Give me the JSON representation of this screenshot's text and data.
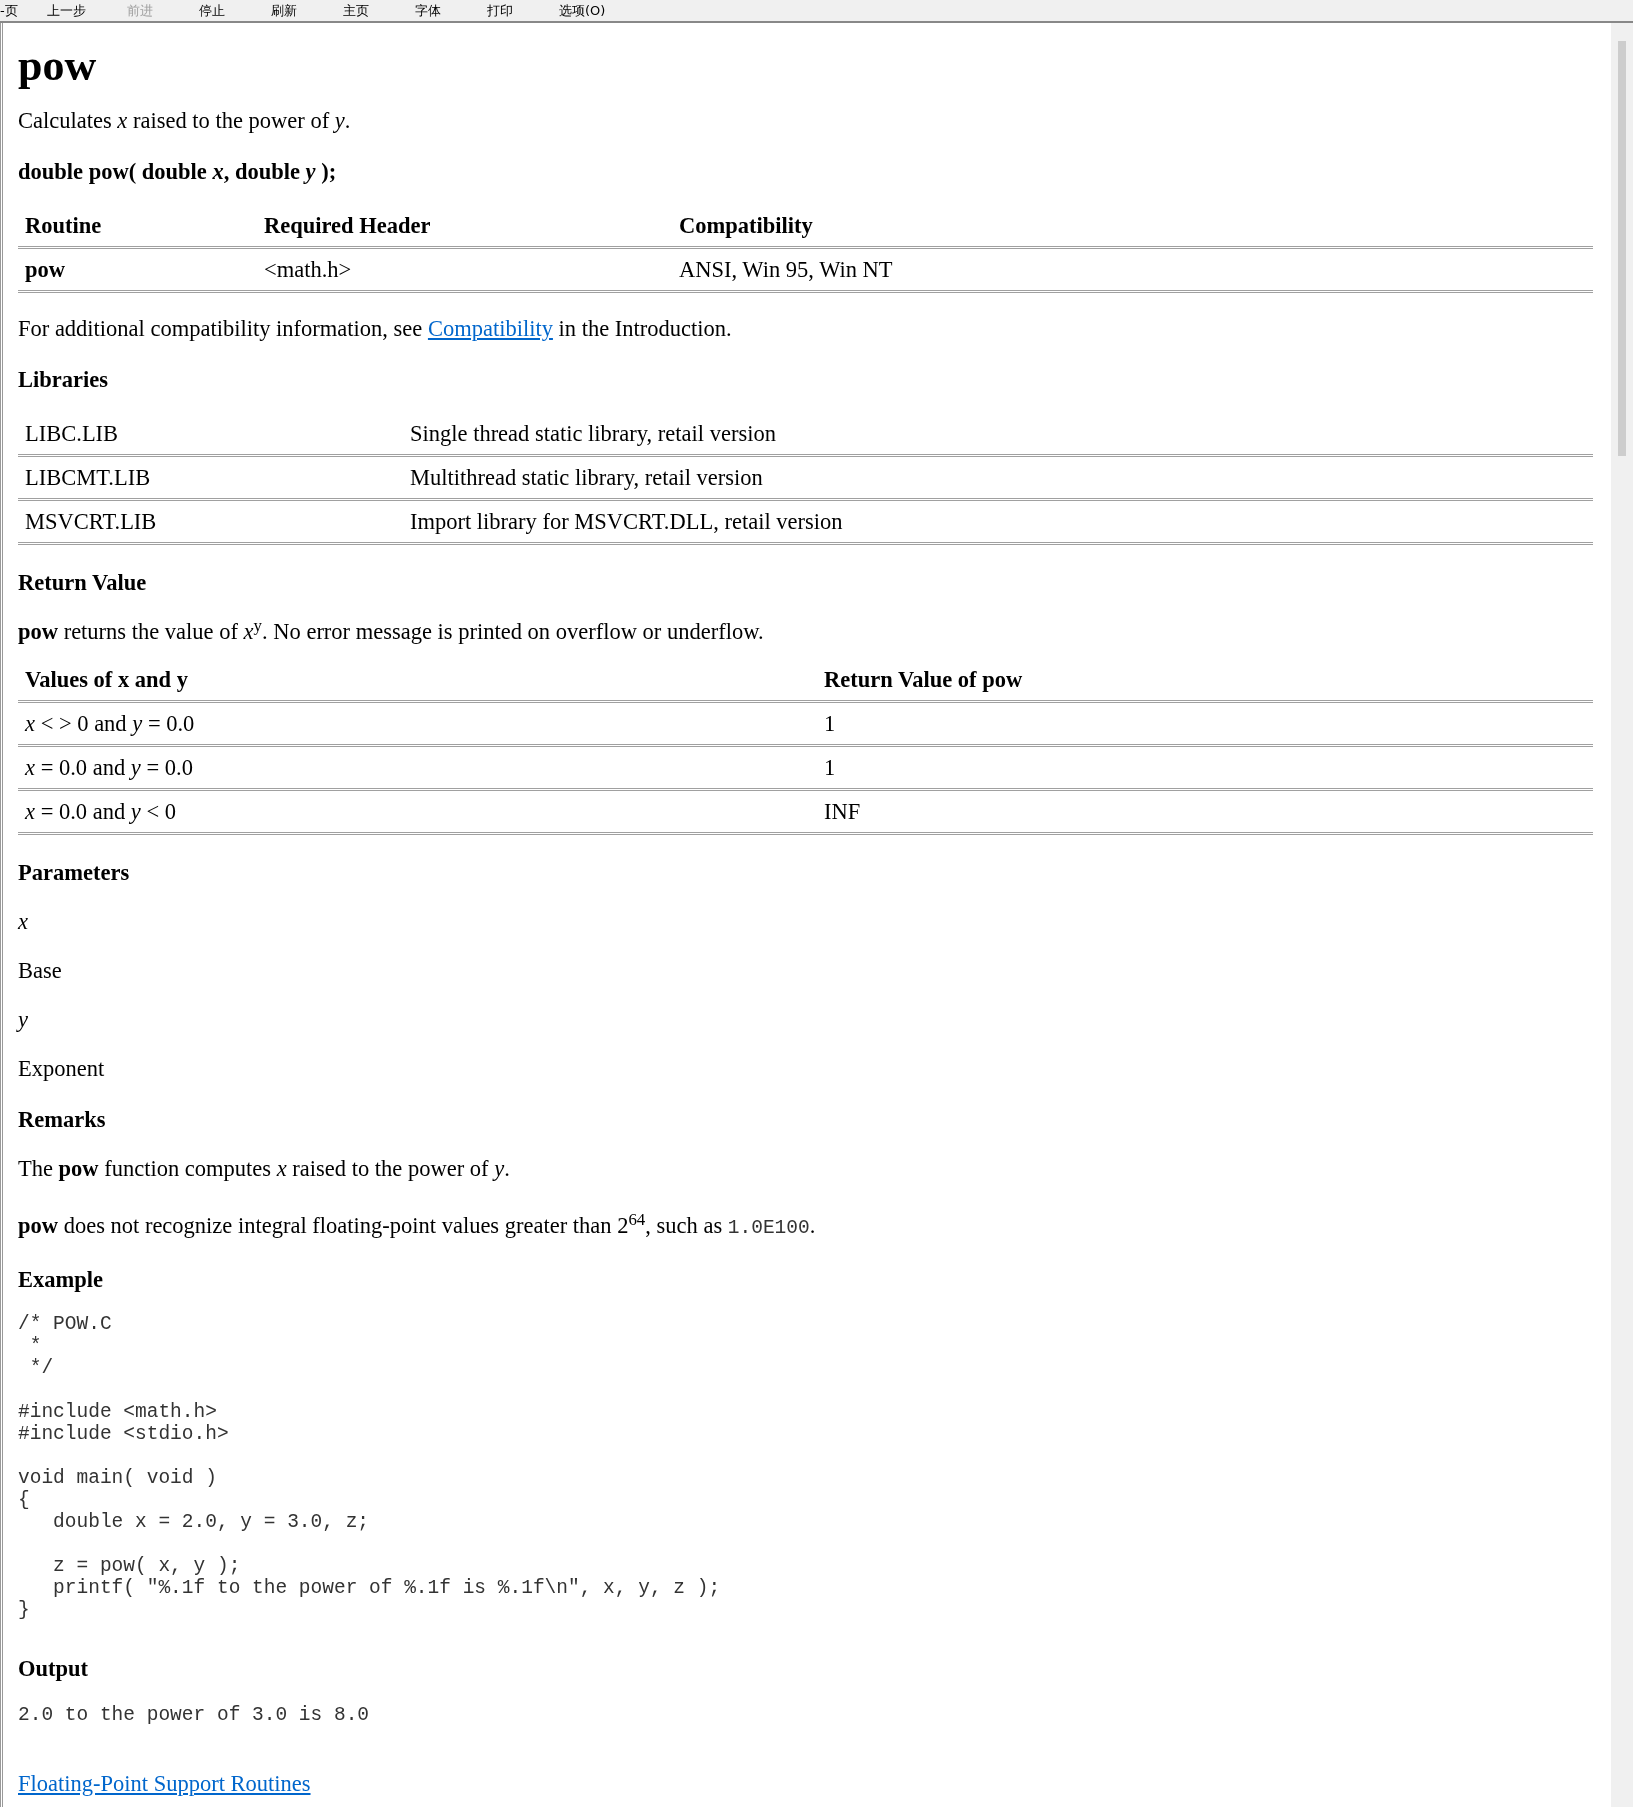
{
  "toolbar": [
    {
      "label": "-页",
      "disabled": false
    },
    {
      "label": "上一步",
      "disabled": false
    },
    {
      "label": "前进",
      "disabled": true
    },
    {
      "label": "停止",
      "disabled": false
    },
    {
      "label": "刷新",
      "disabled": false
    },
    {
      "label": "主页",
      "disabled": false
    },
    {
      "label": "字体",
      "disabled": false
    },
    {
      "label": "打印",
      "disabled": false
    },
    {
      "label": "选项(O)",
      "disabled": false
    }
  ],
  "title": "pow",
  "summary": "Calculates *x* raised to the power of *y*.",
  "syntax": "double pow( double *x*, double *y* );",
  "requirements_table": {
    "columns": [
      "Routine",
      "Required Header",
      "Compatibility"
    ],
    "rows": [
      [
        "pow",
        "<math.h>",
        "ANSI, Win 95, Win NT"
      ]
    ]
  },
  "compat_note": [
    {
      "kind": "text",
      "text": "For additional compatibility information, see "
    },
    {
      "kind": "link",
      "text": "Compatibility"
    },
    {
      "kind": "text",
      "text": " in the Introduction."
    }
  ],
  "libraries_heading": "Libraries",
  "libraries": [
    [
      "LIBC.LIB",
      "Single thread static library, retail version"
    ],
    [
      "LIBCMT.LIB",
      "Multithread static library, retail version"
    ],
    [
      "MSVCRT.LIB",
      "Import library for MSVCRT.DLL, retail version"
    ]
  ],
  "return_heading": "Return Value",
  "return_text": "**pow** returns the value of *x*$^{y}$. No error message is printed on overflow or underflow.",
  "values_table": {
    "columns": [
      "Values of x and y",
      "Return Value of pow"
    ],
    "rows": [
      [
        "*x* < > 0 and *y* = 0.0",
        "1"
      ],
      [
        "*x* = 0.0 and *y* = 0.0",
        "1"
      ],
      [
        "*x* = 0.0 and *y* < 0",
        "INF"
      ]
    ]
  },
  "parameters_heading": "Parameters",
  "parameters": [
    {
      "name": "x",
      "description": "Base"
    },
    {
      "name": "y",
      "description": "Exponent"
    }
  ],
  "remarks_heading": "Remarks",
  "remarks": [
    [
      {
        "kind": "text",
        "text": "The **pow** function computes *x* raised to the power of *y*."
      }
    ],
    [
      {
        "kind": "text",
        "text": "**pow** does not recognize integral floating-point values greater than 2$^{64}$, such as "
      },
      {
        "kind": "code",
        "text": "1.0E100"
      },
      {
        "kind": "text",
        "text": "."
      }
    ]
  ],
  "example_heading": "Example",
  "example_code": "/* POW.C\n *\n */\n\n#include <math.h>\n#include <stdio.h>\n\nvoid main( void )\n{\n   double x = 2.0, y = 3.0, z;\n\n   z = pow( x, y );\n   printf( \"%.1f to the power of %.1f is %.1f\\n\", x, y, z );\n}",
  "output_heading": "Output",
  "output_code": "2.0 to the power of 3.0 is 8.0",
  "footer_link": "Floating-Point Support Routines"
}
